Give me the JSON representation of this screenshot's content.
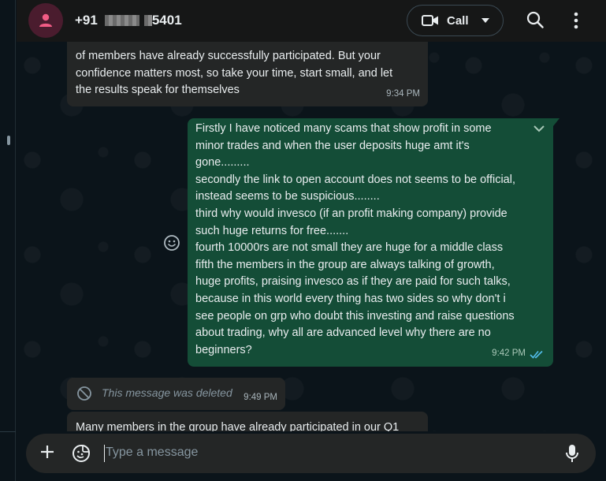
{
  "header": {
    "contact_prefix": "+91",
    "contact_suffix": "5401",
    "call_label": "Call",
    "icons": [
      "person-icon",
      "video-icon",
      "chevron-down-icon",
      "search-icon",
      "more-vert-icon"
    ]
  },
  "messages": [
    {
      "type": "incoming",
      "lines": [
        "of members have already successfully participated. But your",
        "confidence matters most, so take your time, start small, and let",
        "the results speak for themselves"
      ],
      "time": "9:34 PM"
    },
    {
      "type": "outgoing",
      "lines": [
        "Firstly I have noticed many scams that show profit in some",
        "minor trades and when the user deposits huge amt it's",
        "gone.........",
        "secondly the link to open account does not seems to be official,",
        "instead seems to be suspicious........",
        "third why would invesco (if an profit making company) provide",
        "such huge returns for free.......",
        "fourth 10000rs are not small they are huge for a middle class",
        "fifth the members in the group are always talking of growth,",
        "huge profits, praising invesco as if they are paid for such talks,",
        "because in this world every thing has two sides so why don't i",
        "see people on grp who doubt this investing and raise questions",
        "about trading, why all are advanced level why there are no",
        "beginners?"
      ],
      "time": "9:42 PM",
      "status": "read"
    },
    {
      "type": "deleted",
      "text": "This message was deleted",
      "time": "9:49 PM"
    },
    {
      "type": "incoming",
      "lines": [
        "Many members in the group have already participated in our Q1"
      ]
    }
  ],
  "composer": {
    "placeholder": "Type a message"
  },
  "colors": {
    "background": "#0b141a",
    "incoming_bubble": "#242626",
    "outgoing_bubble": "#144d37",
    "read_ticks": "#53bdeb",
    "avatar_bg": "#4a1c2e",
    "avatar_fg": "#f15c85"
  }
}
